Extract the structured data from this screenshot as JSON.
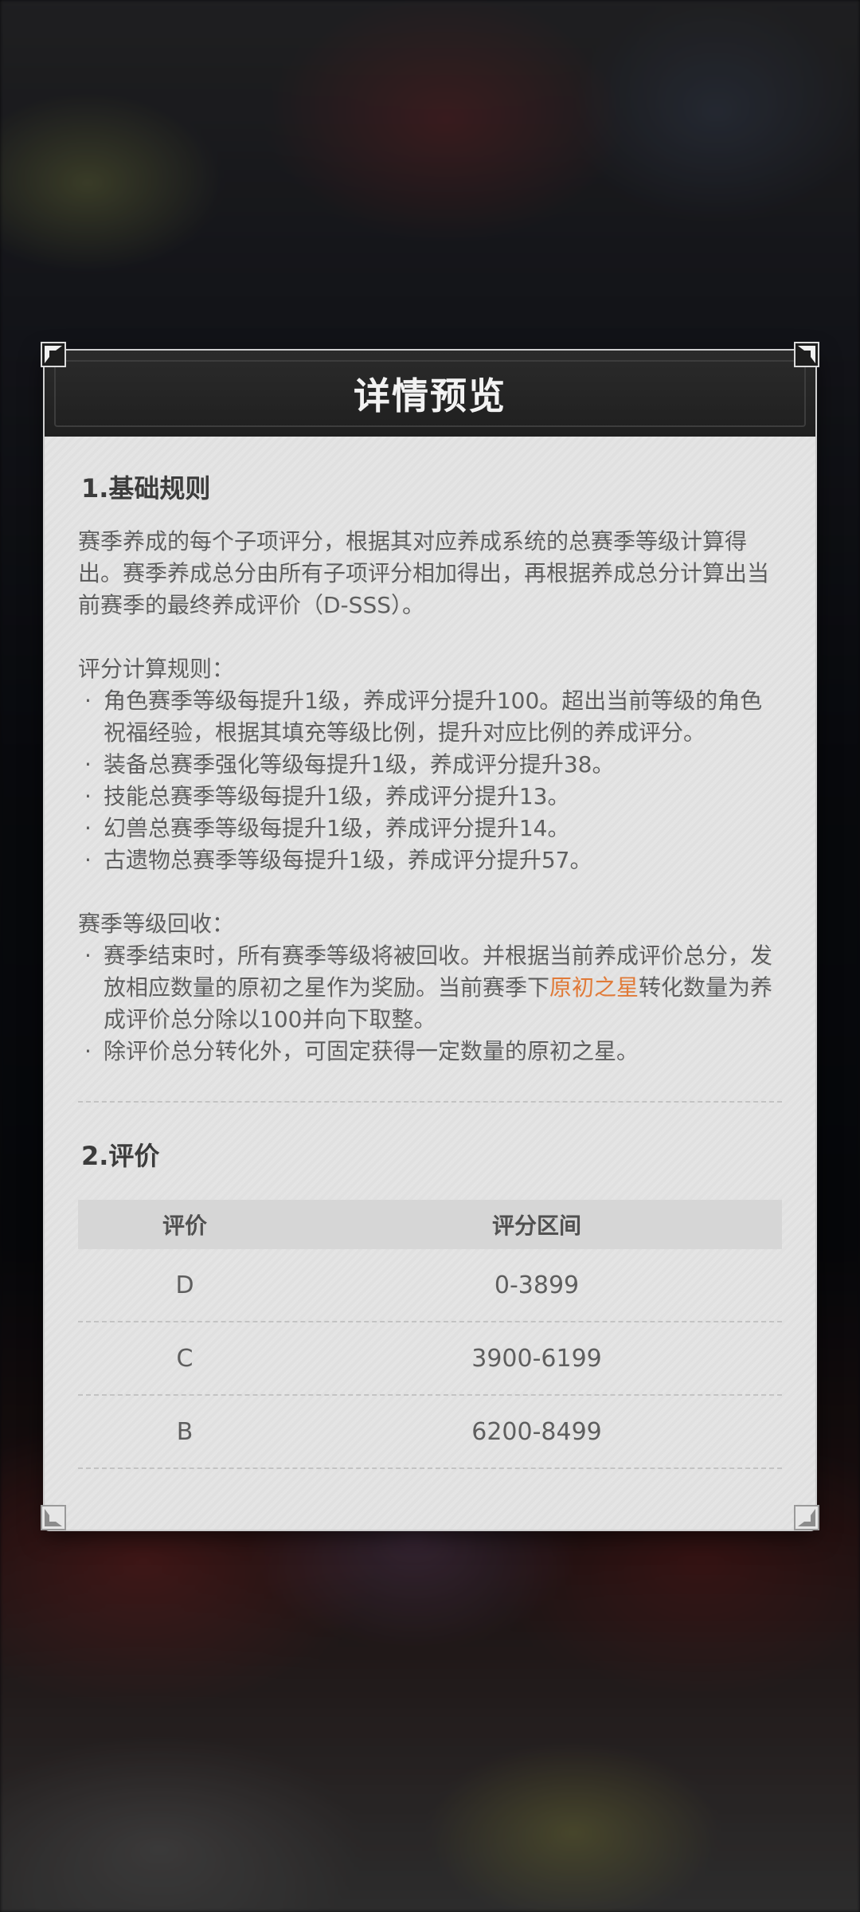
{
  "dialog": {
    "title": "详情预览",
    "section1": {
      "title": "1.基础规则",
      "intro": "赛季养成的每个子项评分，根据其对应养成系统的总赛季等级计算得出。赛季养成总分由所有子项评分相加得出，再根据养成总分计算出当前赛季的最终养成评价（D-SSS）。",
      "calc_heading": "评分计算规则：",
      "calc_rules": [
        "角色赛季等级每提升1级，养成评分提升100。超出当前等级的角色祝福经验，根据其填充等级比例，提升对应比例的养成评分。",
        "装备总赛季强化等级每提升1级，养成评分提升38。",
        "技能总赛季等级每提升1级，养成评分提升13。",
        "幻兽总赛季等级每提升1级，养成评分提升14。",
        "古遗物总赛季等级每提升1级，养成评分提升57。"
      ],
      "recycle_heading": "赛季等级回收：",
      "recycle_rule1_part1": "赛季结束时，所有赛季等级将被回收。并根据当前养成评价总分，发放相应数量的原初之星作为奖励。当前赛季下",
      "recycle_rule1_highlight": "原初之星",
      "recycle_rule1_part2": "转化数量为养成评价总分除以100并向下取整。",
      "recycle_rule2": "除评价总分转化外，可固定获得一定数量的原初之星。",
      "highlight_color": "#e07a38"
    },
    "section2": {
      "title": "2.评价",
      "columns": {
        "grade": "评价",
        "range": "评分区间"
      },
      "rows": [
        {
          "grade": "D",
          "range": "0-3899"
        },
        {
          "grade": "C",
          "range": "3900-6199"
        },
        {
          "grade": "B",
          "range": "6200-8499"
        }
      ]
    }
  },
  "colors": {
    "header_bg": "#232323",
    "panel_bg": "#e4e4e4",
    "title_underline": "#d6dc3c"
  },
  "icons": {
    "corner": "ornament-corner-icon"
  }
}
